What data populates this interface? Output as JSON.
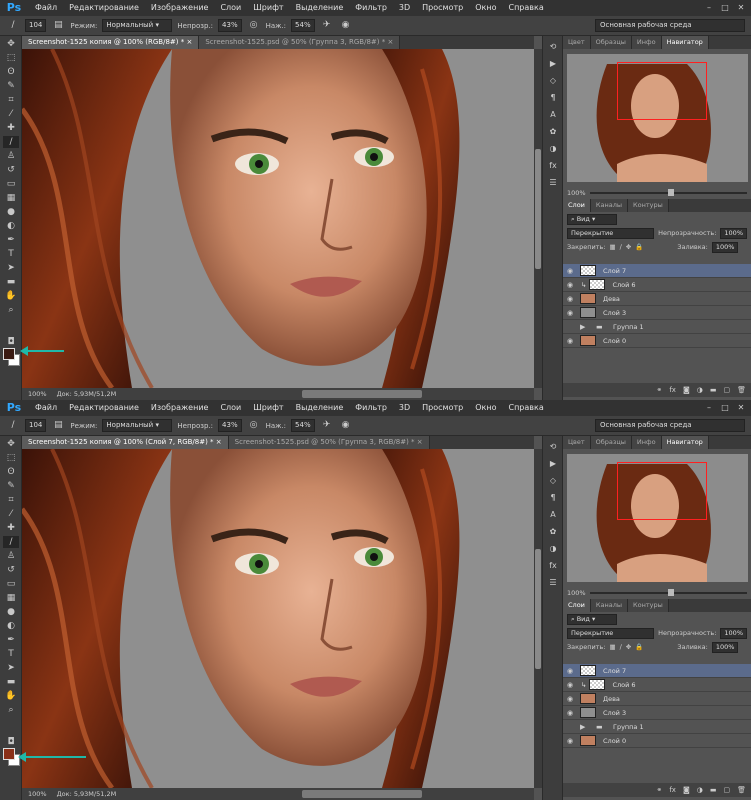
{
  "menu": {
    "logo": "Ps",
    "items": [
      "Файл",
      "Редактирование",
      "Изображение",
      "Слои",
      "Шрифт",
      "Выделение",
      "Фильтр",
      "3D",
      "Просмотр",
      "Окно",
      "Справка"
    ]
  },
  "options": {
    "brush_size": "104",
    "mode_label": "Режим:",
    "mode_value": "Нормальный",
    "opacity_label": "Непрозр.:",
    "opacity_value": "43%",
    "pressure_label": "Наж.:",
    "pressure_value": "54%",
    "workspace": "Основная рабочая среда"
  },
  "screens": [
    {
      "tabs": [
        {
          "label": "Screenshot-1525 копия @ 100% (RGB/8#) *",
          "active": true
        },
        {
          "label": "Screenshot-1525.psd @ 50% (Группа 3, RGB/8#) *",
          "active": false
        }
      ],
      "status": {
        "zoom": "100%",
        "doc": "Док: 5,93M/51,2M"
      },
      "foreground_color": "#3a1a12"
    },
    {
      "tabs": [
        {
          "label": "Screenshot-1525 копия @ 100% (Слой 7, RGB/8#) *",
          "active": true
        },
        {
          "label": "Screenshot-1525.psd @ 50% (Группа 3, RGB/8#) *",
          "active": false
        }
      ],
      "status": {
        "zoom": "100%",
        "doc": "Док: 5,93M/51,2M"
      },
      "foreground_color": "#8a3018"
    }
  ],
  "panels": {
    "top_tabs": [
      "Цвет",
      "Образцы",
      "Инфо",
      "Навигатор"
    ],
    "navigator_zoom": "100%",
    "navigator_zoom_level": 0.5,
    "layer_tabs": [
      "Слои",
      "Каналы",
      "Контуры"
    ],
    "kind_label": "Вид",
    "blend_mode": "Перекрытие",
    "opacity_label": "Непрозрачность:",
    "opacity_value": "100%",
    "lock_label": "Закрепить:",
    "fill_label": "Заливка:",
    "fill_value": "100%",
    "layers": [
      {
        "name": "Слой 7",
        "thumb": "trans",
        "active": true,
        "visible": true,
        "clipped": false,
        "folder": false
      },
      {
        "name": "Слой 6",
        "thumb": "trans",
        "active": false,
        "visible": true,
        "clipped": true,
        "folder": false
      },
      {
        "name": "Дева",
        "thumb": "face",
        "active": false,
        "visible": true,
        "clipped": false,
        "folder": false
      },
      {
        "name": "Слой 3",
        "thumb": "gray",
        "active": false,
        "visible": true,
        "clipped": false,
        "folder": false
      },
      {
        "name": "Группа 1",
        "thumb": "",
        "active": false,
        "visible": false,
        "clipped": false,
        "folder": true
      },
      {
        "name": "Слой 0",
        "thumb": "face",
        "active": false,
        "visible": true,
        "clipped": false,
        "folder": false
      }
    ]
  },
  "icons": {
    "tools": [
      "move-icon",
      "marquee-icon",
      "lasso-icon",
      "quick-select-icon",
      "crop-icon",
      "eyedropper-icon",
      "healing-icon",
      "brush-icon",
      "stamp-icon",
      "history-brush-icon",
      "eraser-icon",
      "gradient-icon",
      "blur-icon",
      "dodge-icon",
      "pen-icon",
      "type-icon",
      "path-select-icon",
      "shape-icon",
      "hand-icon",
      "zoom-icon"
    ],
    "dock": [
      "history-icon",
      "actions-icon",
      "3d-icon",
      "paragraph-icon",
      "character-icon",
      "brush-presets-icon",
      "adjustments-icon",
      "styles-icon",
      "properties-icon"
    ]
  }
}
